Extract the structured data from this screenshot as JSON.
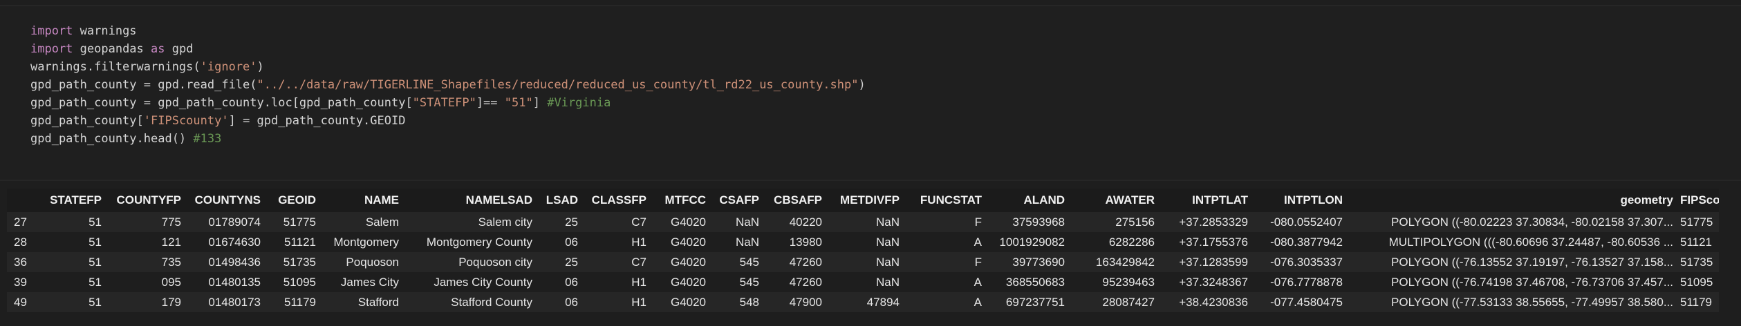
{
  "code": {
    "l1_kw": "import",
    "l1_rest": " warnings",
    "l2_kw": "import",
    "l2_mid": " geopandas ",
    "l2_kw2": "as",
    "l2_rest": " gpd",
    "l3_a": "warnings.filterwarnings(",
    "l3_str": "'ignore'",
    "l3_b": ")",
    "l4_a": "gpd_path_county = gpd.read_file(",
    "l4_str": "\"../../data/raw/TIGERLINE_Shapefiles/reduced/reduced_us_county/tl_rd22_us_county.shp\"",
    "l4_b": ")",
    "l5_a": "gpd_path_county = gpd_path_county.loc[gpd_path_county[",
    "l5_str": "\"STATEFP\"",
    "l5_b": "]== ",
    "l5_str2": "\"51\"",
    "l5_c": "] ",
    "l5_cmt": "#Virginia",
    "l6_a": "gpd_path_county[",
    "l6_str": "'FIPScounty'",
    "l6_b": "] = gpd_path_county.GEOID",
    "l7_a": "gpd_path_county.head() ",
    "l7_cmt": "#133"
  },
  "table": {
    "columns": [
      "",
      "STATEFP",
      "COUNTYFP",
      "COUNTYNS",
      "GEOID",
      "NAME",
      "NAMELSAD",
      "LSAD",
      "CLASSFP",
      "MTFCC",
      "CSAFP",
      "CBSAFP",
      "METDIVFP",
      "FUNCSTAT",
      "ALAND",
      "AWATER",
      "INTPTLAT",
      "INTPTLON",
      "geometry",
      "FIPScounty"
    ],
    "rows": [
      [
        "27",
        "51",
        "775",
        "01789074",
        "51775",
        "Salem",
        "Salem city",
        "25",
        "C7",
        "G4020",
        "NaN",
        "40220",
        "NaN",
        "F",
        "37593968",
        "275156",
        "+37.2853329",
        "-080.0552407",
        "POLYGON ((-80.02223 37.30834, -80.02158 37.307...",
        "51775"
      ],
      [
        "28",
        "51",
        "121",
        "01674630",
        "51121",
        "Montgomery",
        "Montgomery County",
        "06",
        "H1",
        "G4020",
        "NaN",
        "13980",
        "NaN",
        "A",
        "1001929082",
        "6282286",
        "+37.1755376",
        "-080.3877942",
        "MULTIPOLYGON (((-80.60696 37.24487, -80.60536 ...",
        "51121"
      ],
      [
        "36",
        "51",
        "735",
        "01498436",
        "51735",
        "Poquoson",
        "Poquoson city",
        "25",
        "C7",
        "G4020",
        "545",
        "47260",
        "NaN",
        "F",
        "39773690",
        "163429842",
        "+37.1283599",
        "-076.3035337",
        "POLYGON ((-76.13552 37.19197, -76.13527 37.158...",
        "51735"
      ],
      [
        "39",
        "51",
        "095",
        "01480135",
        "51095",
        "James City",
        "James City County",
        "06",
        "H1",
        "G4020",
        "545",
        "47260",
        "NaN",
        "A",
        "368550683",
        "95239463",
        "+37.3248367",
        "-076.7778878",
        "POLYGON ((-76.74198 37.46708, -76.73706 37.457...",
        "51095"
      ],
      [
        "49",
        "51",
        "179",
        "01480173",
        "51179",
        "Stafford",
        "Stafford County",
        "06",
        "H1",
        "G4020",
        "548",
        "47900",
        "47894",
        "A",
        "697237751",
        "28087427",
        "+38.4230836",
        "-077.4580475",
        "POLYGON ((-77.53133 38.55655, -77.49957 38.580...",
        "51179"
      ]
    ]
  }
}
